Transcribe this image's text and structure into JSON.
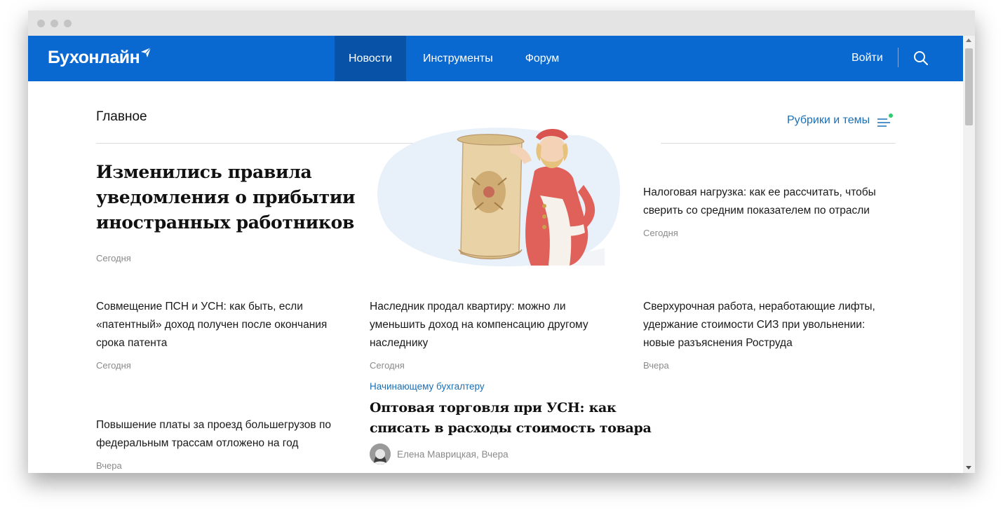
{
  "browser": {
    "dots": [
      "close",
      "minimize",
      "maximize"
    ]
  },
  "header": {
    "logo": "Бухонлайн",
    "nav": [
      {
        "label": "Новости",
        "active": true
      },
      {
        "label": "Инструменты",
        "active": false
      },
      {
        "label": "Форум",
        "active": false
      }
    ],
    "login": "Войти",
    "search_icon": "search-icon",
    "colors": {
      "bar": "#0a69d1",
      "active_tab": "#0853a8"
    }
  },
  "main": {
    "section_title": "Главное",
    "rubrics_label": "Рубрики и темы",
    "rubrics_icon": "menu-lines-icon",
    "lead": {
      "title": "Изменились правила уведомления о прибытии иностранных работников",
      "date": "Сегодня"
    },
    "side_article": {
      "title": "Налоговая нагрузка: как ее рассчитать, чтобы сверить со средним показателем по отрасли",
      "date": "Сегодня"
    },
    "articles": [
      {
        "title": "Совмещение ПСН и УСН: как быть, если «патентный» доход получен после окончания срока патента",
        "date": "Сегодня"
      },
      {
        "title": "Наследник продал квартиру: можно ли уменьшить доход на компенсацию другому наследнику",
        "date": "Сегодня"
      },
      {
        "title": "Сверхурочная работа, неработающие лифты, удержание стоимости СИЗ при увольнении: новые разъяснения Роструда",
        "date": "Вчера"
      },
      {
        "title": "Повышение платы за проезд большегрузов по федеральным трассам отложено на год",
        "date": "Вчера"
      }
    ],
    "featured": {
      "rubric": "Начинающему бухгалтеру",
      "title": "Оптовая торговля при УСН: как списать в расходы стоимость товара",
      "author": "Елена Маврицкая, Вчера"
    },
    "accent_color": "#1a6fb5",
    "notification_dot_color": "#2ecc71"
  }
}
